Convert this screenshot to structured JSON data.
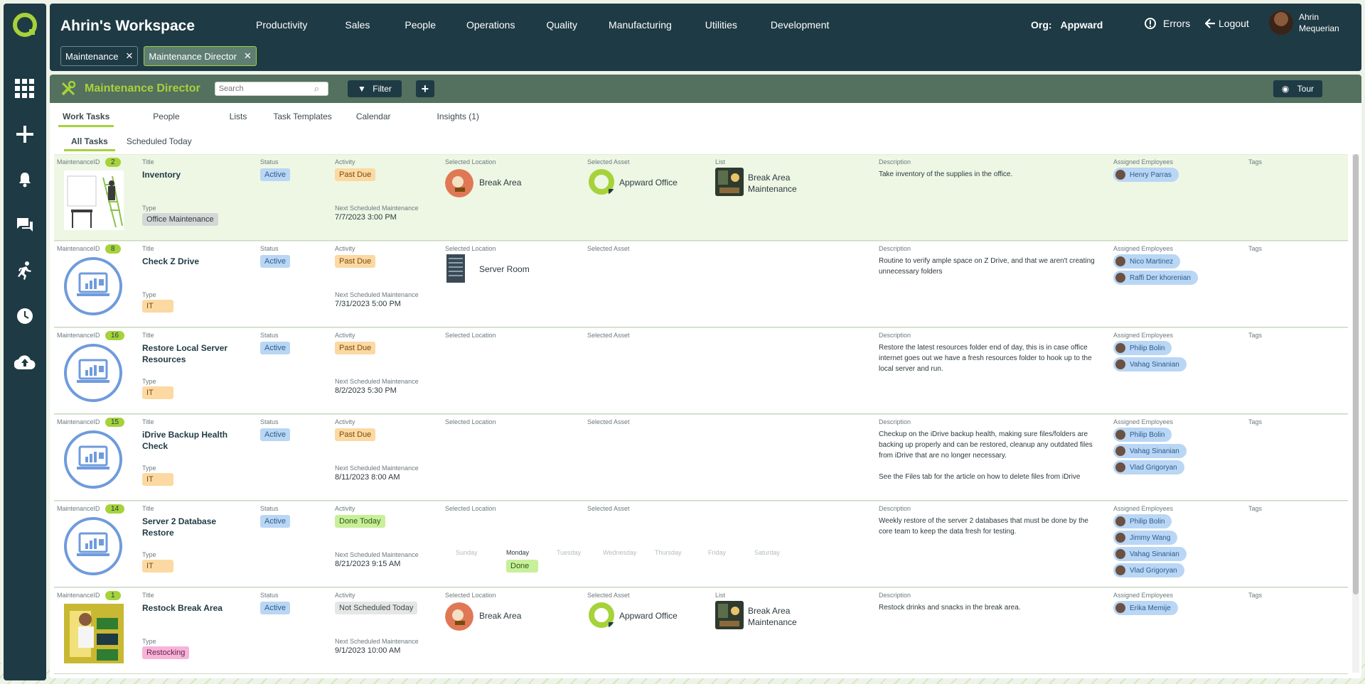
{
  "workspace": {
    "title": "Ahrin's Workspace"
  },
  "nav": [
    "Productivity",
    "Sales",
    "People",
    "Operations",
    "Quality",
    "Manufacturing",
    "Utilities",
    "Development"
  ],
  "org": {
    "label": "Org:",
    "value": "Appward"
  },
  "header_actions": {
    "errors": "Errors",
    "logout": "Logout"
  },
  "user": {
    "name": "Ahrin Mequerian"
  },
  "chips": [
    {
      "label": "Maintenance"
    },
    {
      "label": "Maintenance Director"
    }
  ],
  "page": {
    "title": "Maintenance Director",
    "search_placeholder": "Search",
    "filter": "Filter",
    "tour": "Tour"
  },
  "tabs": [
    "Work Tasks",
    "People",
    "Lists",
    "Task Templates",
    "Calendar",
    "Insights (1)"
  ],
  "subtabs": [
    "All Tasks",
    "Scheduled Today"
  ],
  "labels": {
    "maintenance_id": "MaintenanceID",
    "title": "Title",
    "type": "Type",
    "status": "Status",
    "activity": "Activity",
    "next": "Next Scheduled Maintenance",
    "location": "Selected Location",
    "asset": "Selected Asset",
    "list": "List",
    "description": "Description",
    "employees": "Assigned Employees",
    "tags": "Tags"
  },
  "days": [
    "Sunday",
    "Monday",
    "Tuesday",
    "Wednesday",
    "Thursday",
    "Friday",
    "Saturday"
  ],
  "rows": [
    {
      "id": "2",
      "title": "Inventory",
      "type": "Office Maintenance",
      "status": "Active",
      "activity": "Past Due",
      "next": "7/7/2023 3:00 PM",
      "location": "Break Area",
      "asset": "Appward Office",
      "list": "Break Area Maintenance",
      "description": "Take inventory of the supplies in the office.",
      "employees": [
        "Henry Parras"
      ]
    },
    {
      "id": "8",
      "title": "Check Z Drive",
      "type": "IT",
      "status": "Active",
      "activity": "Past Due",
      "next": "7/31/2023 5:00 PM",
      "location": "Server Room",
      "asset": "",
      "list": "",
      "description": "Routine to verify ample space on Z Drive, and that we aren't creating unnecessary folders",
      "employees": [
        "Nico Martinez",
        "Raffi Der khorenian"
      ]
    },
    {
      "id": "16",
      "title": "Restore Local Server Resources",
      "type": "IT",
      "status": "Active",
      "activity": "Past Due",
      "next": "8/2/2023 5:30 PM",
      "location": "",
      "asset": "",
      "list": "",
      "description": "Restore the latest resources folder end of day, this is in case office internet goes out we have a fresh resources folder to hook up to the local server and run.",
      "employees": [
        "Philip Bolin",
        "Vahag Sinanian"
      ]
    },
    {
      "id": "15",
      "title": "iDrive Backup Health Check",
      "type": "IT",
      "status": "Active",
      "activity": "Past Due",
      "next": "8/11/2023 8:00 AM",
      "location": "",
      "asset": "",
      "list": "",
      "description": "Checkup on the iDrive backup health, making sure files/folders are backing up properly and can be restored, cleanup any outdated files from iDrive that are no longer necessary.\n\nSee the Files tab for the article on how to delete files from iDrive",
      "employees": [
        "Philip Bolin",
        "Vahag Sinanian",
        "Vlad Grigoryan"
      ]
    },
    {
      "id": "14",
      "title": "Server 2 Database Restore",
      "type": "IT",
      "status": "Active",
      "activity": "Done Today",
      "next": "8/21/2023 9:15 AM",
      "location": "",
      "asset": "",
      "list": "",
      "done_day": "Done",
      "description": "Weekly restore of the server 2 databases that must be done by the core team to keep the data fresh for testing.",
      "employees": [
        "Philip Bolin",
        "Jimmy Wang",
        "Vahag Sinanian",
        "Vlad Grigoryan"
      ]
    },
    {
      "id": "1",
      "title": "Restock Break Area",
      "type": "Restocking",
      "status": "Active",
      "activity": "Not Scheduled Today",
      "next": "9/1/2023 10:00 AM",
      "location": "Break Area",
      "asset": "Appward Office",
      "list": "Break Area Maintenance",
      "description": "Restock drinks and snacks in the break area.",
      "employees": [
        "Erika Memije"
      ]
    }
  ],
  "colors": {
    "rail": "#1e3a44",
    "accent": "#a6d23a",
    "toolbar": "#54705f"
  }
}
